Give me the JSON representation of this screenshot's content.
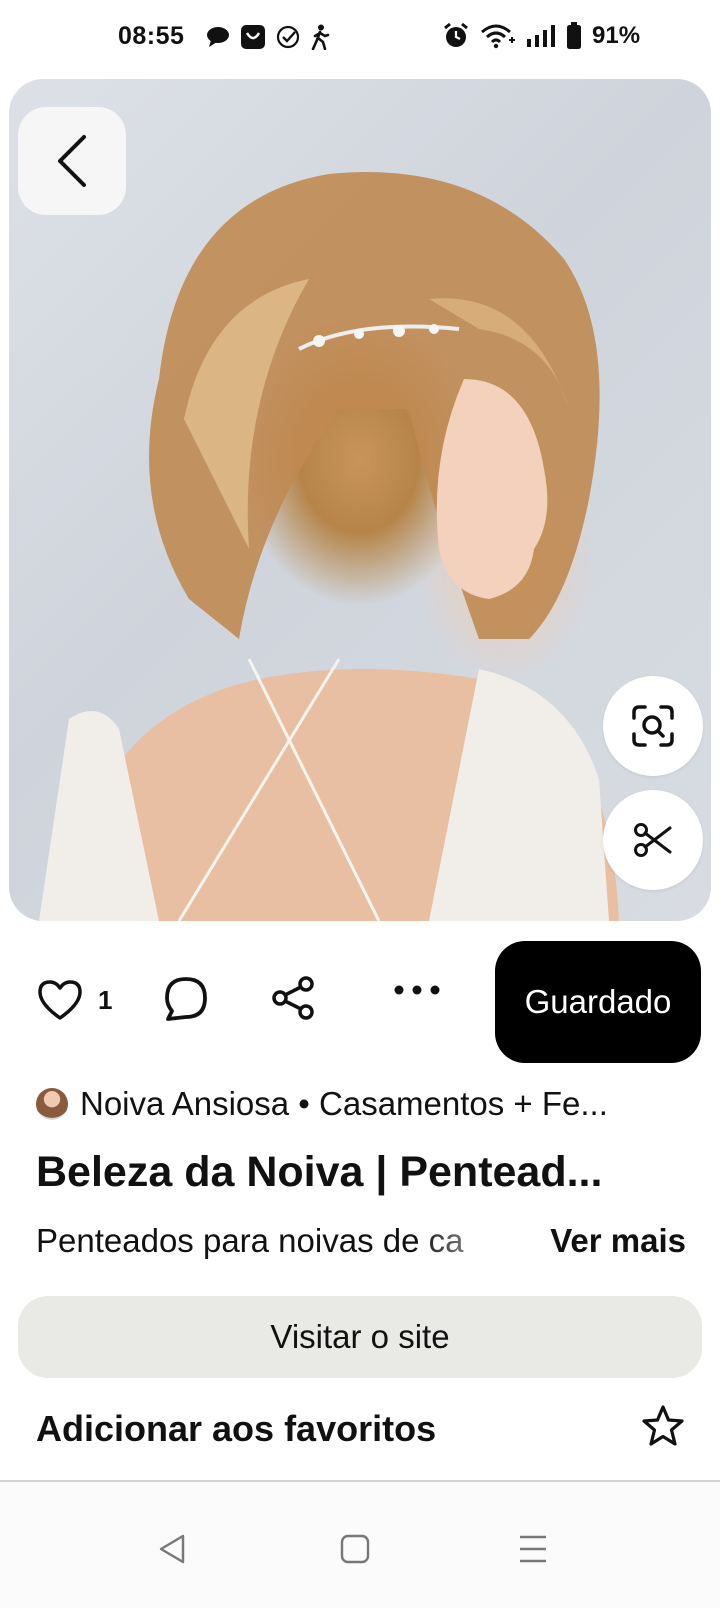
{
  "status_bar": {
    "time": "08:55",
    "battery": "91%",
    "left_icons": [
      "chat-bubble-icon",
      "shopping-bag-icon",
      "check-circle-icon",
      "walking-icon"
    ],
    "right_icons": [
      "alarm-icon",
      "wifi-icon",
      "signal-icon",
      "battery-icon"
    ]
  },
  "pin": {
    "image_alt": "",
    "like_count": "1",
    "save_label": "Guardado",
    "creator": "Noiva Ansiosa • Casamentos + Fe...",
    "title": "Beleza da Noiva | Pentead...",
    "description": "Penteados para noivas de ca",
    "see_more": "Ver mais",
    "visit_label": "Visitar o site",
    "favorites_label": "Adicionar aos favoritos"
  },
  "colors": {
    "save_bg": "#000000",
    "visit_bg": "#e9e9e6",
    "text": "#111111"
  }
}
